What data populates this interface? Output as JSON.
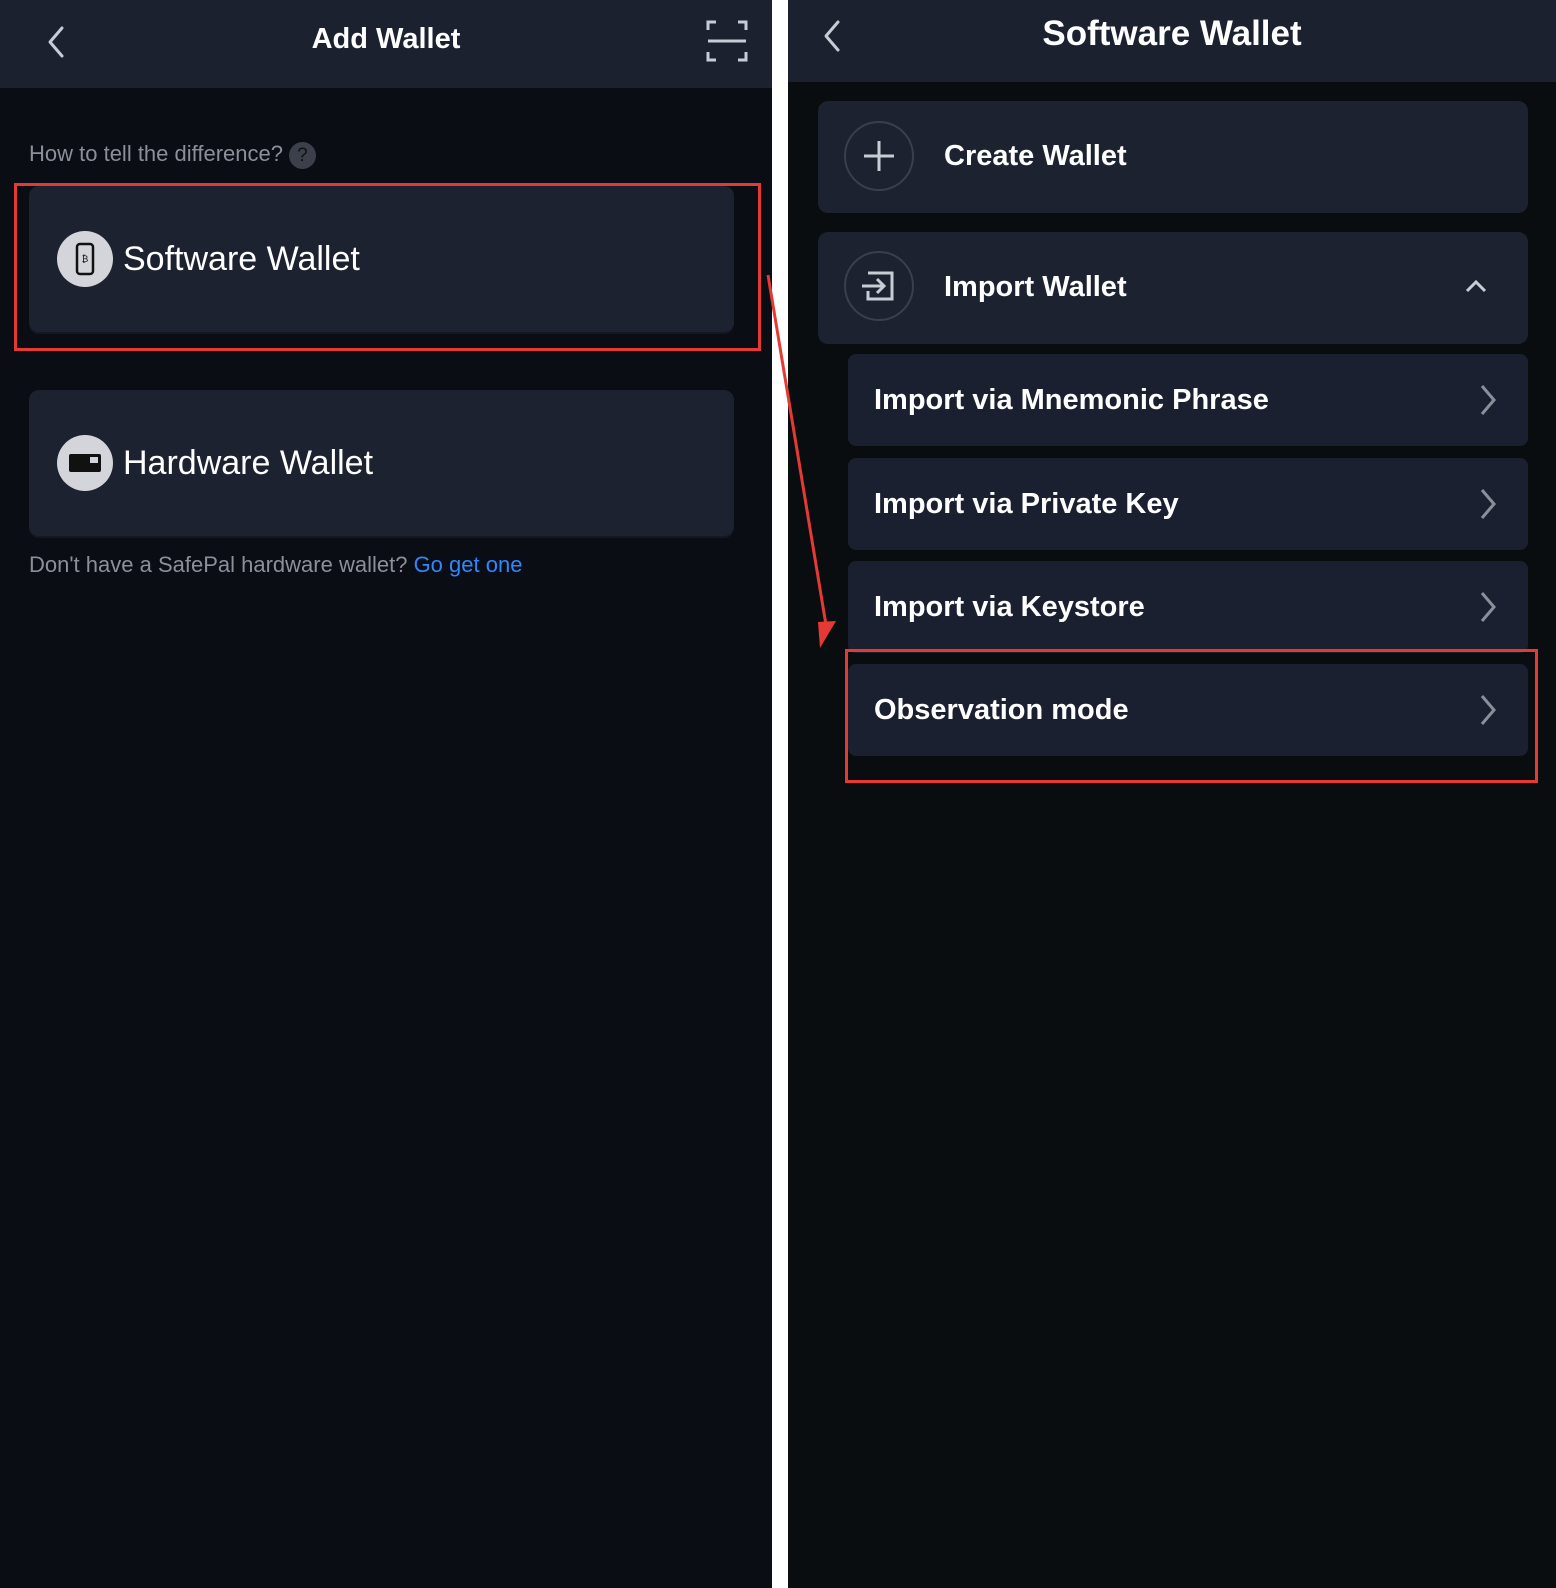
{
  "left": {
    "header": {
      "title": "Add Wallet"
    },
    "hint": {
      "text": "How to tell the difference?",
      "help_glyph": "?"
    },
    "options": [
      {
        "label": "Software Wallet",
        "icon": "phone-wallet-icon"
      },
      {
        "label": "Hardware Wallet",
        "icon": "card-wallet-icon"
      }
    ],
    "footer": {
      "text": "Don't have a SafePal hardware wallet?",
      "link": "Go get one"
    }
  },
  "right": {
    "header": {
      "title": "Software Wallet"
    },
    "create": {
      "label": "Create Wallet"
    },
    "import": {
      "label": "Import Wallet"
    },
    "import_options": [
      {
        "label": "Import via Mnemonic Phrase"
      },
      {
        "label": "Import via Private Key"
      },
      {
        "label": "Import via Keystore"
      },
      {
        "label": "Observation mode"
      }
    ]
  },
  "colors": {
    "highlight": "#e53935",
    "link": "#2f86ff",
    "card": "#1d2230",
    "header": "#1c2130"
  }
}
